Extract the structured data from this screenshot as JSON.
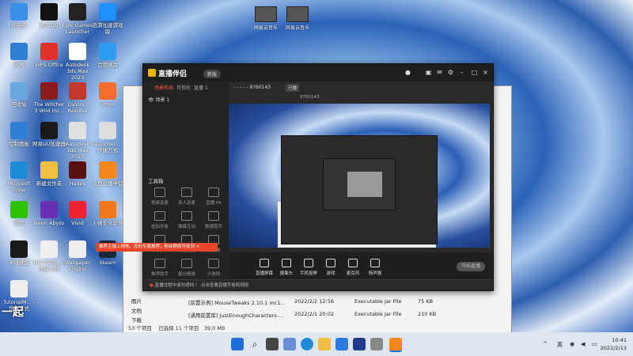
{
  "desktop": {
    "icons": [
      {
        "label": "此电脑",
        "color": "#3a8ee6"
      },
      {
        "label": "腾讯QQ",
        "color": "#111111"
      },
      {
        "label": "Epic Games Launcher",
        "color": "#222222"
      },
      {
        "label": "迅游加速游戏版",
        "color": "#1e90ff"
      },
      {
        "label": "网络",
        "color": "#2f7fd4"
      },
      {
        "label": "WPS Office",
        "color": "#e0322b"
      },
      {
        "label": "Autodesk 3ds Max 2023",
        "color": "#ffffff"
      },
      {
        "label": "百度网盘",
        "color": "#2f9cf2"
      },
      {
        "label": "回收站",
        "color": "#6aa7e0"
      },
      {
        "label": "The Witcher 3 Wild Hu...",
        "color": "#8b1a1a"
      },
      {
        "label": "DaVinci Resolve",
        "color": "#c0392b"
      },
      {
        "label": "Origin",
        "color": "#f56c2d"
      },
      {
        "label": "控制面板",
        "color": "#2f7fd4"
      },
      {
        "label": "网易UU加速器",
        "color": "#1a1a1a"
      },
      {
        "label": "Autodesk 3ds Max 2023",
        "color": "#e0e0e0"
      },
      {
        "label": "Launcher... - 快捷方式",
        "color": "#dddddd"
      },
      {
        "label": "Microsoft Edge",
        "color": "#1f8ad6"
      },
      {
        "label": "新建文件夹",
        "color": "#f2c040"
      },
      {
        "label": "Hades",
        "color": "#5a1010"
      },
      {
        "label": "斗鱼直播伴侣",
        "color": "#f5871f"
      },
      {
        "label": "微信",
        "color": "#2dc100"
      },
      {
        "label": "Neon Abyss",
        "color": "#6b2fb3"
      },
      {
        "label": "Vivid",
        "color": "#e23"
      },
      {
        "label": "火绒安全软件",
        "color": "#f07a1a"
      },
      {
        "label": "英雄联盟",
        "color": "#1a1a1a"
      },
      {
        "label": "NNClient... - 快捷方式",
        "color": "#eeeeee"
      },
      {
        "label": "Wallpaper Engine",
        "color": "#eeeeee"
      },
      {
        "label": "Steam",
        "color": "#1b2838"
      },
      {
        "label": "TutorialM... - 快捷方式",
        "color": "#eeeeee"
      }
    ],
    "top_icons": [
      {
        "label": "网易云音乐"
      },
      {
        "label": "网易云音乐"
      }
    ]
  },
  "explorer": {
    "sidebar": [
      "图片",
      "文档",
      "下载"
    ],
    "rows": [
      {
        "name": "[前置示例] MouseTweaks 2.10.1 mc1...",
        "date": "2022/2/2 12:56",
        "type": "Executable Jar File",
        "size": "75 KB"
      },
      {
        "name": "[通用前置库] JustEnoughCharacters-...",
        "date": "2022/2/1 20:02",
        "type": "Executable Jar File",
        "size": "210 KB"
      }
    ],
    "status": [
      "53 个项目",
      "已选择 11 个项目",
      "39.0 MB"
    ]
  },
  "app": {
    "title": "直播伴侣",
    "version": "新版",
    "left_tabs": [
      "场景布局",
      "可视化",
      "直播 1"
    ],
    "scene": "场景 1",
    "tools_header": "工具箱",
    "tools": [
      {
        "label": "视频连麦"
      },
      {
        "label": "多人连麦"
      },
      {
        "label": "直播 PK"
      },
      {
        "label": "虚拟形象"
      },
      {
        "label": "弹幕互动"
      },
      {
        "label": "数据助手"
      },
      {
        "label": "录屏"
      },
      {
        "label": "开播提醒"
      },
      {
        "label": "快捷键"
      },
      {
        "label": "推荐助手"
      },
      {
        "label": "蛋分精选"
      },
      {
        "label": "小游戏"
      }
    ],
    "tooltip": "推荐主播上线啦，您的专属推荐，粉丝群即可收到",
    "info": {
      "room_id": "9760143",
      "room_tag": "已播",
      "line1": "9760143",
      "status": "开播"
    },
    "bottom_buttons": [
      {
        "label": "直播屏幕"
      },
      {
        "label": "摄像头"
      },
      {
        "label": "手机投屏"
      },
      {
        "label": "游戏"
      },
      {
        "label": "麦克风"
      },
      {
        "label": "扬声器"
      }
    ],
    "live_button": "开始直播",
    "notice": "直播过程中请勿遮挡 ！ 点击查看直播手册和规则"
  },
  "taskbar": {
    "ime": "英",
    "time": "10:41",
    "date": "2022/2/13"
  },
  "watermark": "一起"
}
